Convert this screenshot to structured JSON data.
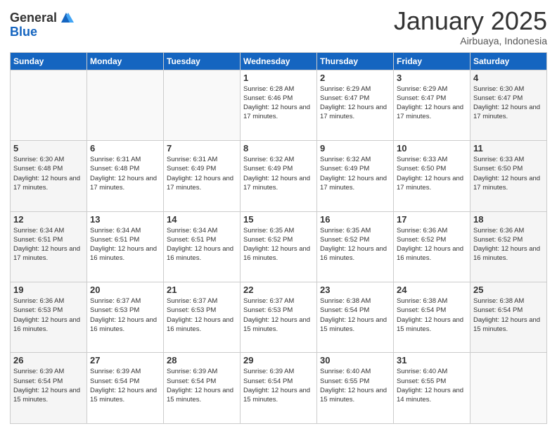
{
  "logo": {
    "general": "General",
    "blue": "Blue"
  },
  "header": {
    "month": "January 2025",
    "location": "Airbuaya, Indonesia"
  },
  "weekdays": [
    "Sunday",
    "Monday",
    "Tuesday",
    "Wednesday",
    "Thursday",
    "Friday",
    "Saturday"
  ],
  "weeks": [
    [
      {
        "day": "",
        "sunrise": "",
        "sunset": "",
        "daylight": ""
      },
      {
        "day": "",
        "sunrise": "",
        "sunset": "",
        "daylight": ""
      },
      {
        "day": "",
        "sunrise": "",
        "sunset": "",
        "daylight": ""
      },
      {
        "day": "1",
        "sunrise": "Sunrise: 6:28 AM",
        "sunset": "Sunset: 6:46 PM",
        "daylight": "Daylight: 12 hours and 17 minutes."
      },
      {
        "day": "2",
        "sunrise": "Sunrise: 6:29 AM",
        "sunset": "Sunset: 6:47 PM",
        "daylight": "Daylight: 12 hours and 17 minutes."
      },
      {
        "day": "3",
        "sunrise": "Sunrise: 6:29 AM",
        "sunset": "Sunset: 6:47 PM",
        "daylight": "Daylight: 12 hours and 17 minutes."
      },
      {
        "day": "4",
        "sunrise": "Sunrise: 6:30 AM",
        "sunset": "Sunset: 6:47 PM",
        "daylight": "Daylight: 12 hours and 17 minutes."
      }
    ],
    [
      {
        "day": "5",
        "sunrise": "Sunrise: 6:30 AM",
        "sunset": "Sunset: 6:48 PM",
        "daylight": "Daylight: 12 hours and 17 minutes."
      },
      {
        "day": "6",
        "sunrise": "Sunrise: 6:31 AM",
        "sunset": "Sunset: 6:48 PM",
        "daylight": "Daylight: 12 hours and 17 minutes."
      },
      {
        "day": "7",
        "sunrise": "Sunrise: 6:31 AM",
        "sunset": "Sunset: 6:49 PM",
        "daylight": "Daylight: 12 hours and 17 minutes."
      },
      {
        "day": "8",
        "sunrise": "Sunrise: 6:32 AM",
        "sunset": "Sunset: 6:49 PM",
        "daylight": "Daylight: 12 hours and 17 minutes."
      },
      {
        "day": "9",
        "sunrise": "Sunrise: 6:32 AM",
        "sunset": "Sunset: 6:49 PM",
        "daylight": "Daylight: 12 hours and 17 minutes."
      },
      {
        "day": "10",
        "sunrise": "Sunrise: 6:33 AM",
        "sunset": "Sunset: 6:50 PM",
        "daylight": "Daylight: 12 hours and 17 minutes."
      },
      {
        "day": "11",
        "sunrise": "Sunrise: 6:33 AM",
        "sunset": "Sunset: 6:50 PM",
        "daylight": "Daylight: 12 hours and 17 minutes."
      }
    ],
    [
      {
        "day": "12",
        "sunrise": "Sunrise: 6:34 AM",
        "sunset": "Sunset: 6:51 PM",
        "daylight": "Daylight: 12 hours and 17 minutes."
      },
      {
        "day": "13",
        "sunrise": "Sunrise: 6:34 AM",
        "sunset": "Sunset: 6:51 PM",
        "daylight": "Daylight: 12 hours and 16 minutes."
      },
      {
        "day": "14",
        "sunrise": "Sunrise: 6:34 AM",
        "sunset": "Sunset: 6:51 PM",
        "daylight": "Daylight: 12 hours and 16 minutes."
      },
      {
        "day": "15",
        "sunrise": "Sunrise: 6:35 AM",
        "sunset": "Sunset: 6:52 PM",
        "daylight": "Daylight: 12 hours and 16 minutes."
      },
      {
        "day": "16",
        "sunrise": "Sunrise: 6:35 AM",
        "sunset": "Sunset: 6:52 PM",
        "daylight": "Daylight: 12 hours and 16 minutes."
      },
      {
        "day": "17",
        "sunrise": "Sunrise: 6:36 AM",
        "sunset": "Sunset: 6:52 PM",
        "daylight": "Daylight: 12 hours and 16 minutes."
      },
      {
        "day": "18",
        "sunrise": "Sunrise: 6:36 AM",
        "sunset": "Sunset: 6:52 PM",
        "daylight": "Daylight: 12 hours and 16 minutes."
      }
    ],
    [
      {
        "day": "19",
        "sunrise": "Sunrise: 6:36 AM",
        "sunset": "Sunset: 6:53 PM",
        "daylight": "Daylight: 12 hours and 16 minutes."
      },
      {
        "day": "20",
        "sunrise": "Sunrise: 6:37 AM",
        "sunset": "Sunset: 6:53 PM",
        "daylight": "Daylight: 12 hours and 16 minutes."
      },
      {
        "day": "21",
        "sunrise": "Sunrise: 6:37 AM",
        "sunset": "Sunset: 6:53 PM",
        "daylight": "Daylight: 12 hours and 16 minutes."
      },
      {
        "day": "22",
        "sunrise": "Sunrise: 6:37 AM",
        "sunset": "Sunset: 6:53 PM",
        "daylight": "Daylight: 12 hours and 15 minutes."
      },
      {
        "day": "23",
        "sunrise": "Sunrise: 6:38 AM",
        "sunset": "Sunset: 6:54 PM",
        "daylight": "Daylight: 12 hours and 15 minutes."
      },
      {
        "day": "24",
        "sunrise": "Sunrise: 6:38 AM",
        "sunset": "Sunset: 6:54 PM",
        "daylight": "Daylight: 12 hours and 15 minutes."
      },
      {
        "day": "25",
        "sunrise": "Sunrise: 6:38 AM",
        "sunset": "Sunset: 6:54 PM",
        "daylight": "Daylight: 12 hours and 15 minutes."
      }
    ],
    [
      {
        "day": "26",
        "sunrise": "Sunrise: 6:39 AM",
        "sunset": "Sunset: 6:54 PM",
        "daylight": "Daylight: 12 hours and 15 minutes."
      },
      {
        "day": "27",
        "sunrise": "Sunrise: 6:39 AM",
        "sunset": "Sunset: 6:54 PM",
        "daylight": "Daylight: 12 hours and 15 minutes."
      },
      {
        "day": "28",
        "sunrise": "Sunrise: 6:39 AM",
        "sunset": "Sunset: 6:54 PM",
        "daylight": "Daylight: 12 hours and 15 minutes."
      },
      {
        "day": "29",
        "sunrise": "Sunrise: 6:39 AM",
        "sunset": "Sunset: 6:54 PM",
        "daylight": "Daylight: 12 hours and 15 minutes."
      },
      {
        "day": "30",
        "sunrise": "Sunrise: 6:40 AM",
        "sunset": "Sunset: 6:55 PM",
        "daylight": "Daylight: 12 hours and 15 minutes."
      },
      {
        "day": "31",
        "sunrise": "Sunrise: 6:40 AM",
        "sunset": "Sunset: 6:55 PM",
        "daylight": "Daylight: 12 hours and 14 minutes."
      },
      {
        "day": "",
        "sunrise": "",
        "sunset": "",
        "daylight": ""
      }
    ]
  ]
}
